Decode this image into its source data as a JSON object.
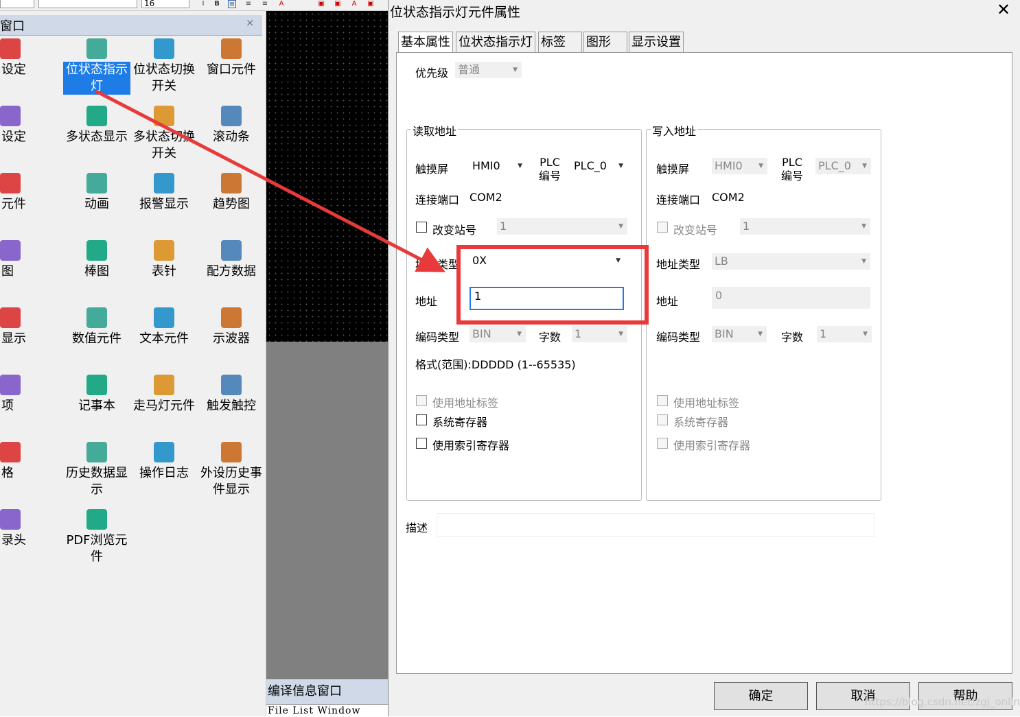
{
  "toolbar": {
    "font_size": "16"
  },
  "toolbox": {
    "title": "窗口",
    "close": "×",
    "items": [
      {
        "label": "设定",
        "icon": "setting-icon"
      },
      {
        "label": "位状态指示灯",
        "icon": "bit-lamp-icon"
      },
      {
        "label": "位状态切换开关",
        "icon": "bit-switch-icon"
      },
      {
        "label": "窗口元件",
        "icon": "window-element-icon"
      },
      {
        "label": "设定",
        "icon": "word-setting-icon"
      },
      {
        "label": "多状态显示",
        "icon": "multi-state-display-icon"
      },
      {
        "label": "多状态切换开关",
        "icon": "multi-state-switch-icon"
      },
      {
        "label": "滚动条",
        "icon": "scrollbar-icon"
      },
      {
        "label": "元件",
        "icon": "element-icon"
      },
      {
        "label": "动画",
        "icon": "animation-icon"
      },
      {
        "label": "报警显示",
        "icon": "alarm-display-icon"
      },
      {
        "label": "趋势图",
        "icon": "trend-chart-icon"
      },
      {
        "label": "图",
        "icon": "xy-chart-icon"
      },
      {
        "label": "棒图",
        "icon": "bar-chart-icon"
      },
      {
        "label": "表针",
        "icon": "meter-icon"
      },
      {
        "label": "配方数据",
        "icon": "recipe-data-icon"
      },
      {
        "label": "显示",
        "icon": "display-icon"
      },
      {
        "label": "数值元件",
        "icon": "numeric-element-icon"
      },
      {
        "label": "文本元件",
        "icon": "text-element-icon"
      },
      {
        "label": "示波器",
        "icon": "oscilloscope-icon"
      },
      {
        "label": "项",
        "icon": "option-icon"
      },
      {
        "label": "记事本",
        "icon": "notepad-icon"
      },
      {
        "label": "走马灯元件",
        "icon": "marquee-icon"
      },
      {
        "label": "触发触控",
        "icon": "touch-trigger-icon"
      },
      {
        "label": "格",
        "icon": "grid-icon"
      },
      {
        "label": "历史数据显示",
        "icon": "history-data-icon"
      },
      {
        "label": "操作日志",
        "icon": "operation-log-icon"
      },
      {
        "label": "外设历史事件显示",
        "icon": "peripheral-history-icon"
      },
      {
        "label": "录头",
        "icon": "camera-icon"
      },
      {
        "label": "PDF浏览元件",
        "icon": "pdf-viewer-icon"
      }
    ]
  },
  "compile_window": {
    "title": "编译信息窗口",
    "file_list": "File List Window"
  },
  "dialog": {
    "title": "位状态指示灯元件属性",
    "close": "✕",
    "tabs": [
      "基本属性",
      "位状态指示灯",
      "标签",
      "图形",
      "显示设置"
    ],
    "priority_label": "优先级",
    "priority_value": "普通",
    "read": {
      "group": "读取地址",
      "touch_label": "触摸屏",
      "touch_value": "HMI0",
      "plc_label_1": "PLC",
      "plc_label_2": "编号",
      "plc_value": "PLC_0",
      "port_label": "连接端口",
      "port_value": "COM2",
      "change_station": "改变站号",
      "station_value": "1",
      "addr_type_label": "地址类型",
      "addr_type_value": "0X",
      "addr_label": "地址",
      "addr_value": "1",
      "encode_label": "编码类型",
      "encode_value": "BIN",
      "words_label": "字数",
      "words_value": "1",
      "format": "格式(范围):DDDDD (1--65535)",
      "use_tag": "使用地址标签",
      "sys_reg": "系统寄存器",
      "index_reg": "使用索引寄存器"
    },
    "write": {
      "group": "写入地址",
      "touch_label": "触摸屏",
      "touch_value": "HMI0",
      "plc_label_1": "PLC",
      "plc_label_2": "编号",
      "plc_value": "PLC_0",
      "port_label": "连接端口",
      "port_value": "COM2",
      "change_station": "改变站号",
      "station_value": "1",
      "addr_type_label": "地址类型",
      "addr_type_value": "LB",
      "addr_label": "地址",
      "addr_value": "0",
      "encode_label": "编码类型",
      "encode_value": "BIN",
      "words_label": "字数",
      "words_value": "1",
      "use_tag": "使用地址标签",
      "sys_reg": "系统寄存器",
      "index_reg": "使用索引寄存器"
    },
    "desc_label": "描述",
    "buttons": {
      "ok": "确定",
      "cancel": "取消",
      "help": "帮助"
    }
  },
  "annotation": {
    "color": "#e83a3a"
  },
  "watermark": "https://blog.csdn.net/zgj_online"
}
